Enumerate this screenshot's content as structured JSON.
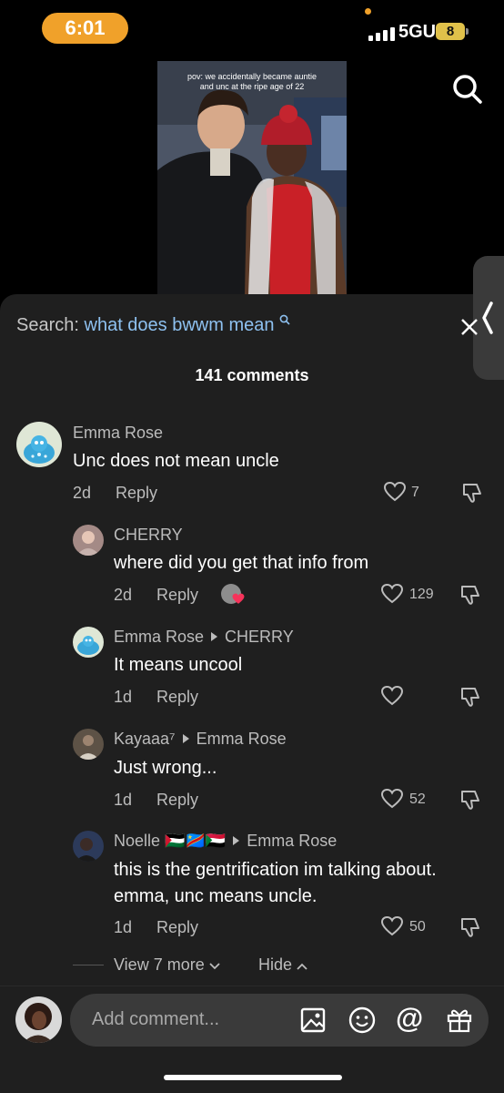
{
  "status_bar": {
    "time": "6:01",
    "network": "5GUC",
    "battery": "8"
  },
  "video": {
    "caption_line1": "pov: we accidentally became auntie",
    "caption_line2": "and unc at the ripe age of 22"
  },
  "sheet": {
    "search_label": "Search:",
    "search_query": "what does bwwm mean",
    "comment_count": "141 comments"
  },
  "comments": [
    {
      "name": "Emma Rose",
      "text": "Unc does not mean uncle",
      "age": "2d",
      "reply": "Reply",
      "likes": "7"
    },
    {
      "name": "CHERRY",
      "text": "where did you get that info from",
      "age": "2d",
      "reply": "Reply",
      "likes": "129"
    },
    {
      "name": "Emma Rose",
      "reply_to": "CHERRY",
      "text": "It means uncool",
      "age": "1d",
      "reply": "Reply",
      "likes": ""
    },
    {
      "name": "Kayaaa⁷",
      "reply_to": "Emma Rose",
      "text": "Just wrong...",
      "age": "1d",
      "reply": "Reply",
      "likes": "52"
    },
    {
      "name": "Noelle 🇵🇸🇨🇩🇸🇩",
      "reply_to": "Emma Rose",
      "text_line1": "this is the gentrification im talking about.",
      "text_line2": "emma, unc means uncle.",
      "age": "1d",
      "reply": "Reply",
      "likes": "50"
    }
  ],
  "thread": {
    "view_more": "View 7 more",
    "hide": "Hide"
  },
  "composer": {
    "placeholder": "Add comment..."
  },
  "colors": {
    "accent_time": "#f0a12a",
    "query_blue": "#8ec1f0",
    "sheet_bg": "#1f1f1f"
  }
}
